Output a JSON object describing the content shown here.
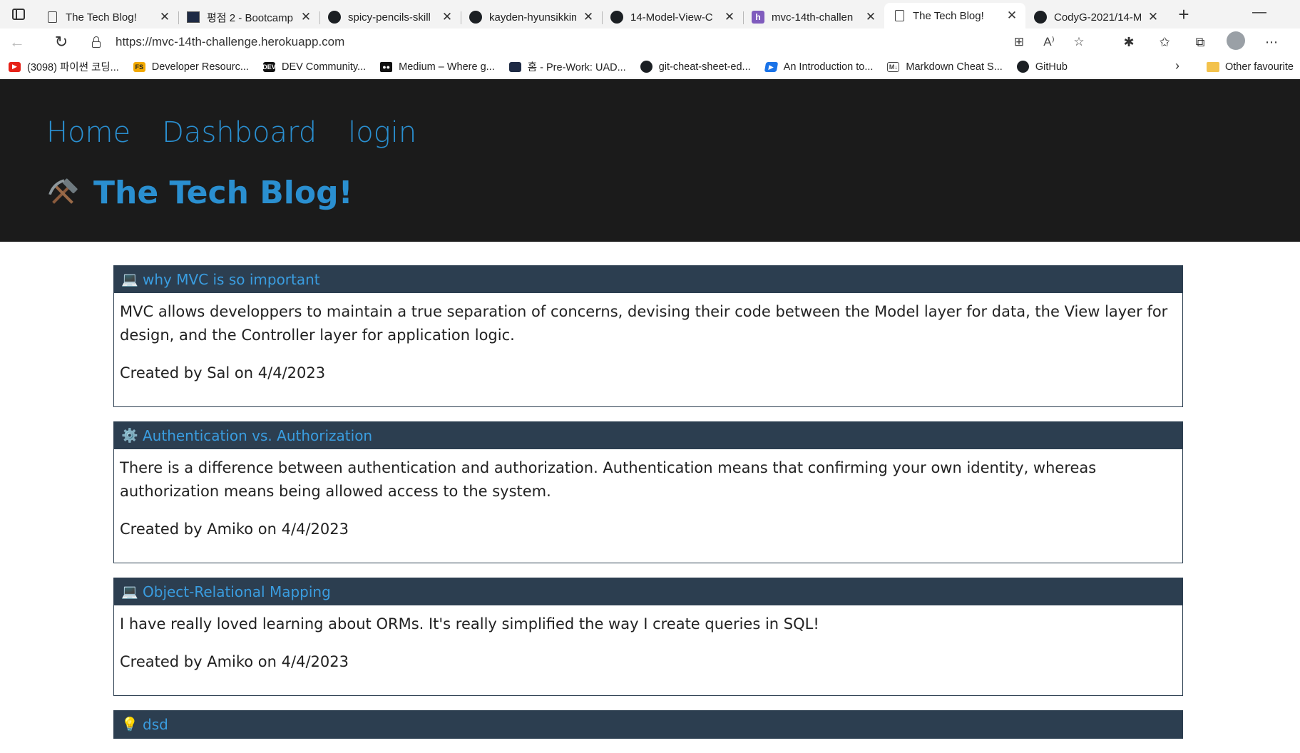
{
  "browser": {
    "tabs": [
      {
        "title": "The Tech Blog!",
        "icon": "page-icon"
      },
      {
        "title": "평점 2 - Bootcamp",
        "icon": "bootcamp-icon"
      },
      {
        "title": "spicy-pencils-skill",
        "icon": "github-icon"
      },
      {
        "title": "kayden-hyunsikkim",
        "icon": "github-icon"
      },
      {
        "title": "14-Model-View-C",
        "icon": "github-icon"
      },
      {
        "title": "mvc-14th-challen",
        "icon": "heroku-icon"
      },
      {
        "title": "The Tech Blog!",
        "icon": "page-icon",
        "active": true
      },
      {
        "title": "CodyG-2021/14-M",
        "icon": "github-icon"
      }
    ],
    "url": "https://mvc-14th-challenge.herokuapp.com",
    "bookmarks": [
      {
        "label": "(3098) 파이썬 코딩...",
        "icon": "youtube-icon"
      },
      {
        "label": "Developer Resourc...",
        "icon": "fs-icon"
      },
      {
        "label": "DEV Community...",
        "icon": "dev-icon"
      },
      {
        "label": "Medium – Where g...",
        "icon": "medium-icon"
      },
      {
        "label": "홈 - Pre-Work: UAD...",
        "icon": "uad-icon"
      },
      {
        "label": "git-cheat-sheet-ed...",
        "icon": "github-icon"
      },
      {
        "label": "An Introduction to...",
        "icon": "intro-icon"
      },
      {
        "label": "Markdown Cheat S...",
        "icon": "markdown-icon"
      },
      {
        "label": "GitHub",
        "icon": "github-icon"
      }
    ],
    "other_favourites": "Other favourite"
  },
  "site": {
    "nav": {
      "home": "Home",
      "dashboard": "Dashboard",
      "login": "login"
    },
    "title": "The Tech Blog!",
    "accent_color": "#2a8fd0",
    "header_bg": "#1b1b1b"
  },
  "posts": [
    {
      "emoji": "💻",
      "title": "why MVC is so important",
      "content": "MVC allows developpers to maintain a true separation of concerns, devising their code between the Model layer for data, the View layer for design, and the Controller layer for application logic.",
      "meta": "Created by Sal on 4/4/2023"
    },
    {
      "emoji": "⚙️",
      "title": "Authentication vs. Authorization",
      "content": "There is a difference between authentication and authorization. Authentication means that confirming your own identity, whereas authorization means being allowed access to the system.",
      "meta": "Created by Amiko on 4/4/2023"
    },
    {
      "emoji": "💻",
      "title": "Object-Relational Mapping",
      "content": "I have really loved learning about ORMs. It's really simplified the way I create queries in SQL!",
      "meta": "Created by Amiko on 4/4/2023"
    },
    {
      "emoji": "💡",
      "title": "dsd",
      "content": "",
      "meta": ""
    }
  ]
}
